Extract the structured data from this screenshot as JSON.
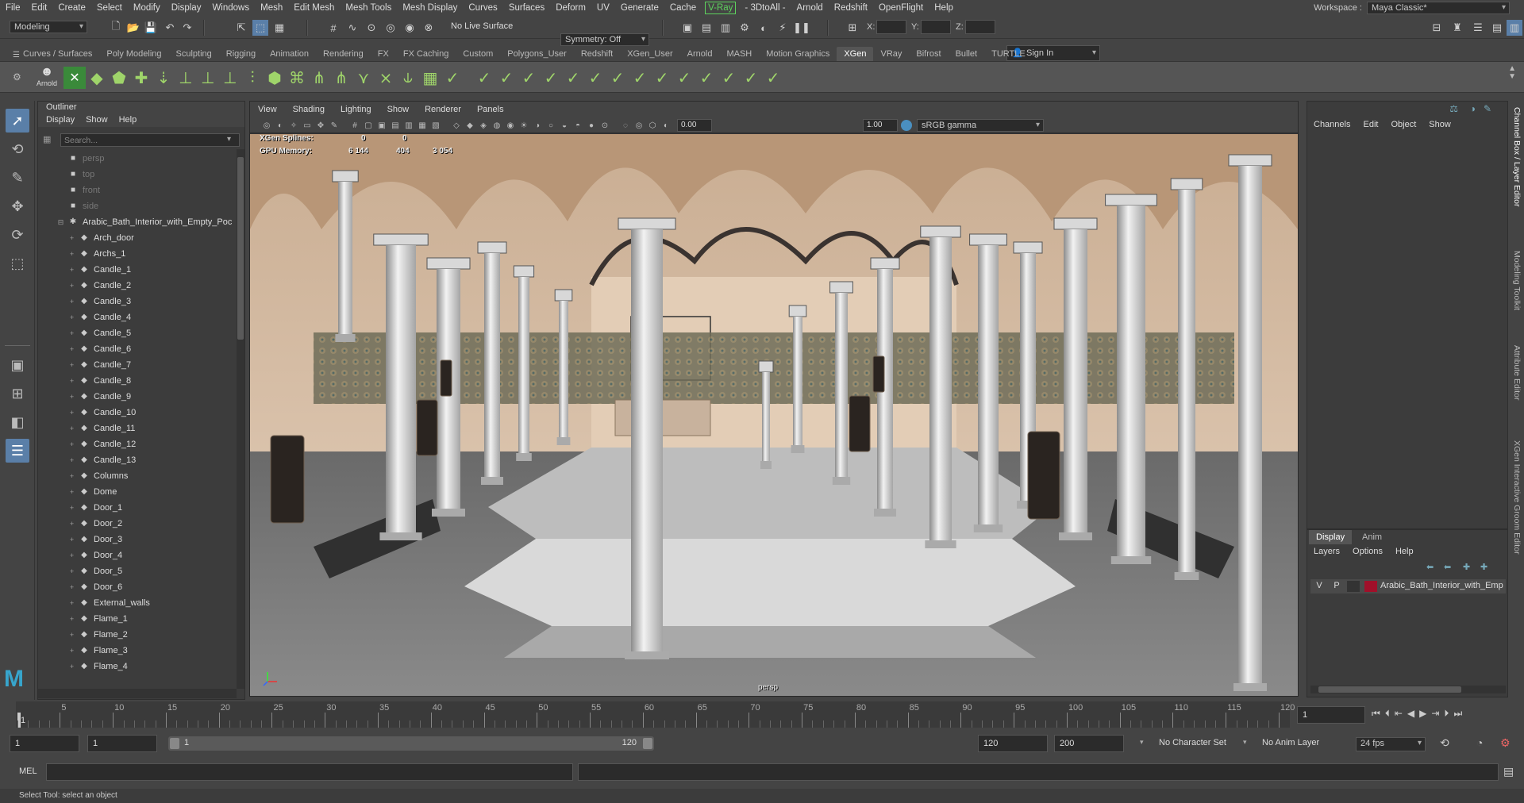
{
  "menubar": {
    "items": [
      "File",
      "Edit",
      "Create",
      "Select",
      "Modify",
      "Display",
      "Windows",
      "Mesh",
      "Edit Mesh",
      "Mesh Tools",
      "Mesh Display",
      "Curves",
      "Surfaces",
      "Deform",
      "UV",
      "Generate",
      "Cache"
    ],
    "vray": "V-Ray",
    "items2": [
      "- 3DtoAll -",
      "Arnold",
      "Redshift",
      "OpenFlight",
      "Help"
    ],
    "workspace_label": "Workspace :",
    "workspace_value": "Maya Classic*"
  },
  "statusline": {
    "mode": "Modeling",
    "live_surface": "No Live Surface",
    "symmetry": "Symmetry: Off",
    "x_label": "X:",
    "y_label": "Y:",
    "z_label": "Z:",
    "sign_in": "Sign In"
  },
  "shelf": {
    "tabs": [
      "Curves / Surfaces",
      "Poly Modeling",
      "Sculpting",
      "Rigging",
      "Animation",
      "Rendering",
      "FX",
      "FX Caching",
      "Custom",
      "Polygons_User",
      "Redshift",
      "XGen_User",
      "Arnold",
      "MASH",
      "Motion Graphics",
      "XGen",
      "VRay",
      "Bifrost",
      "Bullet",
      "TURTLE"
    ],
    "active_tab": "XGen",
    "arnold_label": "Arnold"
  },
  "outliner": {
    "title": "Outliner",
    "menus": [
      "Display",
      "Show",
      "Help"
    ],
    "search_placeholder": "Search...",
    "cameras": [
      "persp",
      "top",
      "front",
      "side"
    ],
    "root": "Arabic_Bath_Interior_with_Empty_Poc",
    "children": [
      "Arch_door",
      "Archs_1",
      "Candle_1",
      "Candle_2",
      "Candle_3",
      "Candle_4",
      "Candle_5",
      "Candle_6",
      "Candle_7",
      "Candle_8",
      "Candle_9",
      "Candle_10",
      "Candle_11",
      "Candle_12",
      "Candle_13",
      "Columns",
      "Dome",
      "Door_1",
      "Door_2",
      "Door_3",
      "Door_4",
      "Door_5",
      "Door_6",
      "External_walls",
      "Flame_1",
      "Flame_2",
      "Flame_3",
      "Flame_4"
    ]
  },
  "viewport": {
    "menus": [
      "View",
      "Shading",
      "Lighting",
      "Show",
      "Renderer",
      "Panels"
    ],
    "exposure": "0.00",
    "gamma": "1.00",
    "colorspace": "sRGB gamma",
    "hud": {
      "splines_label": "XGen Splines:",
      "splines_a": "0",
      "splines_b": "0",
      "gpu_label": "GPU Memory:",
      "gpu_a": "6 144",
      "gpu_b": "404",
      "gpu_c": "3 054"
    },
    "camera_label": "persp"
  },
  "channelbox": {
    "menus": [
      "Channels",
      "Edit",
      "Object",
      "Show"
    ]
  },
  "layers": {
    "tabs": [
      "Display",
      "Anim"
    ],
    "menus": [
      "Layers",
      "Options",
      "Help"
    ],
    "row_v": "V",
    "row_p": "P",
    "layer_name": "Arabic_Bath_Interior_with_Emp",
    "layer_color": "#a0102a"
  },
  "sidetabs": [
    "Channel Box / Layer Editor",
    "Modeling Toolkit",
    "Attribute Editor",
    "XGen Interactive Groom Editor"
  ],
  "timeline": {
    "labels": [
      "5",
      "10",
      "15",
      "20",
      "25",
      "30",
      "35",
      "40",
      "45",
      "50",
      "55",
      "60",
      "65",
      "70",
      "75",
      "80",
      "85",
      "90",
      "95",
      "100",
      "105",
      "110",
      "115",
      "120"
    ],
    "current_frame": "1"
  },
  "range": {
    "start": "1",
    "range_start": "1",
    "slider_start": "1",
    "slider_end": "120",
    "range_end": "120",
    "end": "200",
    "character_set": "No Character Set",
    "anim_layer": "No Anim Layer",
    "fps": "24 fps"
  },
  "cmdline": {
    "label": "MEL"
  },
  "helpline": {
    "text": "Select Tool: select an object"
  }
}
